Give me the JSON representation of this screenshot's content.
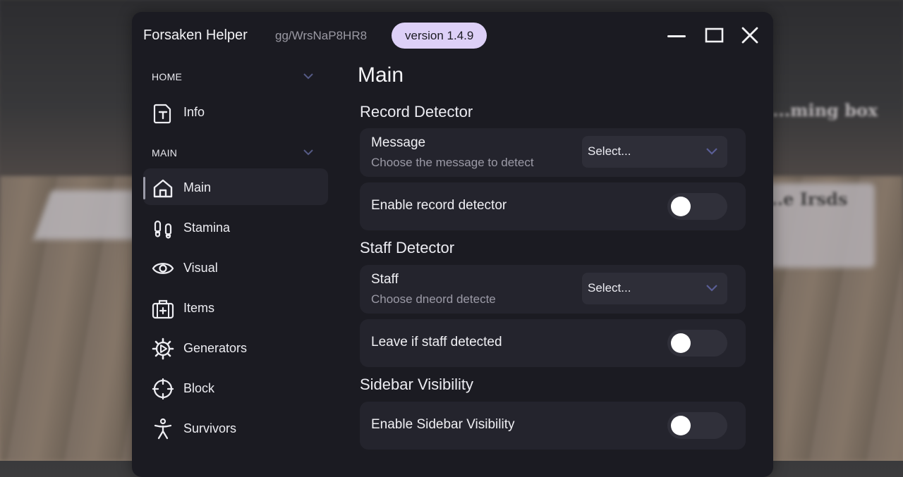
{
  "app": {
    "title": "Forsaken Helper",
    "subtitle": "gg/WrsNaP8HR8",
    "version": "version 1.4.9"
  },
  "background": {
    "text1": "...ming box",
    "text2": "...e Irsds"
  },
  "window_controls": {
    "minimize_icon": "minimize-icon",
    "maximize_icon": "maximize-icon",
    "close_icon": "close-icon"
  },
  "sidebar": {
    "sections": [
      {
        "label": "HOME",
        "items": [
          {
            "label": "Info",
            "icon": "info-document-icon"
          }
        ]
      },
      {
        "label": "MAIN",
        "items": [
          {
            "label": "Main",
            "icon": "home-icon",
            "active": true
          },
          {
            "label": "Stamina",
            "icon": "footprints-icon"
          },
          {
            "label": "Visual",
            "icon": "eye-icon"
          },
          {
            "label": "Items",
            "icon": "medkit-icon"
          },
          {
            "label": "Generators",
            "icon": "gear-icon"
          },
          {
            "label": "Block",
            "icon": "crosshair-icon"
          },
          {
            "label": "Survivors",
            "icon": "person-icon"
          }
        ]
      }
    ]
  },
  "main": {
    "title": "Main",
    "groups": [
      {
        "heading": "Record Detector",
        "rows": [
          {
            "type": "dropdown",
            "title": "Message",
            "description": "Choose the message to detect",
            "value": "Select..."
          },
          {
            "type": "toggle",
            "title": "Enable record detector",
            "on": false
          }
        ]
      },
      {
        "heading": "Staff Detector",
        "rows": [
          {
            "type": "dropdown",
            "title": "Staff",
            "description": "Choose dneord detecte",
            "value": "Select..."
          },
          {
            "type": "toggle",
            "title": "Leave if staff detected",
            "on": false
          }
        ]
      },
      {
        "heading": "Sidebar Visibility",
        "rows": [
          {
            "type": "toggle",
            "title": "Enable Sidebar Visibility",
            "on": false
          }
        ]
      }
    ]
  }
}
